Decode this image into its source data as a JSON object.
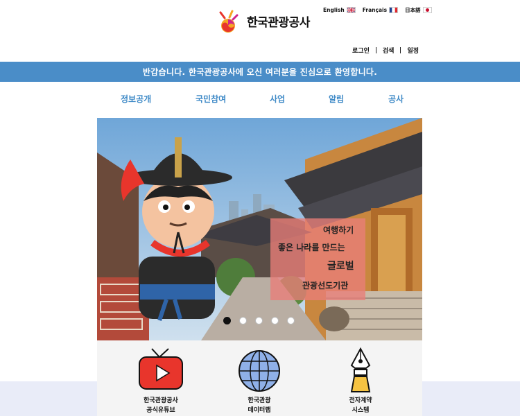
{
  "header": {
    "logo_text": "한국관광공사",
    "languages": [
      {
        "label": "English",
        "flag": "uk-flag-icon"
      },
      {
        "label": "Français",
        "flag": "france-flag-icon"
      },
      {
        "label": "日本語",
        "flag": "japan-flag-icon"
      }
    ],
    "util_nav": [
      "로그인",
      "검색",
      "일정"
    ]
  },
  "banner": {
    "text": "반갑습니다. 한국관광공사에 오신 여러분을 진심으로 환영합니다.",
    "color": "#4a8dc8"
  },
  "main_nav": [
    "정보공개",
    "국민참여",
    "사업",
    "알림",
    "공사"
  ],
  "hero": {
    "lines": [
      "여행하기",
      "좋은 나라를 만드는",
      "글로벌",
      "관광선도기관"
    ],
    "slide_count": 5,
    "active_slide": 1
  },
  "services": [
    {
      "line1": "한국관광공사",
      "line2": "공식유튜브",
      "icon": "youtube-tv-icon"
    },
    {
      "line1": "한국관광",
      "line2": "데이터랩",
      "icon": "globe-icon"
    },
    {
      "line1": "전자계약",
      "line2": "시스템",
      "icon": "fountain-pen-icon"
    }
  ],
  "colors": {
    "accent": "#4a8dc8",
    "nav_text": "#3f8ac7",
    "youtube_red": "#e8352c"
  }
}
